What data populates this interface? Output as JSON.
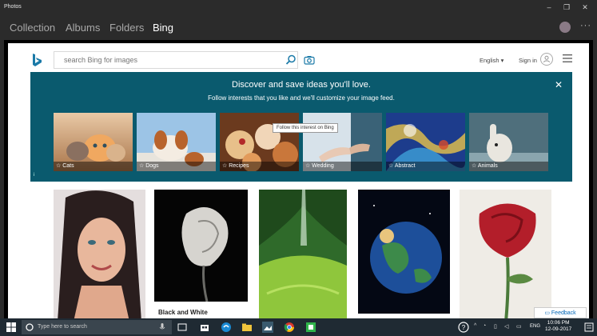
{
  "window": {
    "title": "Photos",
    "controls": [
      "–",
      "❐",
      "✕"
    ]
  },
  "nav": {
    "items": [
      "Collection",
      "Albums",
      "Folders",
      "Bing"
    ],
    "active": "Bing",
    "more": "···"
  },
  "bing": {
    "search_placeholder": "search Bing for images",
    "language": "English ▾",
    "signin": "Sign in"
  },
  "banner": {
    "title": "Discover and save ideas you'll love.",
    "subtitle": "Follow interests that you like and we'll customize your image feed.",
    "tooltip": "Follow this interest on Bing",
    "info": "i",
    "cards": [
      {
        "label": "☆ Cats",
        "color": "#c9a27a"
      },
      {
        "label": "☆ Dogs",
        "color": "#8fb6d8"
      },
      {
        "label": "☆ Recipes",
        "color": "#a0522d"
      },
      {
        "label": "☆ Wedding",
        "color": "#7a9db0"
      },
      {
        "label": "☆ Abstract",
        "color": "#2a5aa8"
      },
      {
        "label": "☆ Animals",
        "color": "#4b6c78"
      }
    ]
  },
  "grid": {
    "caption": "Black and White",
    "feedback": "Feedback"
  },
  "taskbar": {
    "search_label": "Type here to search",
    "lang": "ENG",
    "time": "10:06 PM",
    "date": "12-09-2017"
  }
}
